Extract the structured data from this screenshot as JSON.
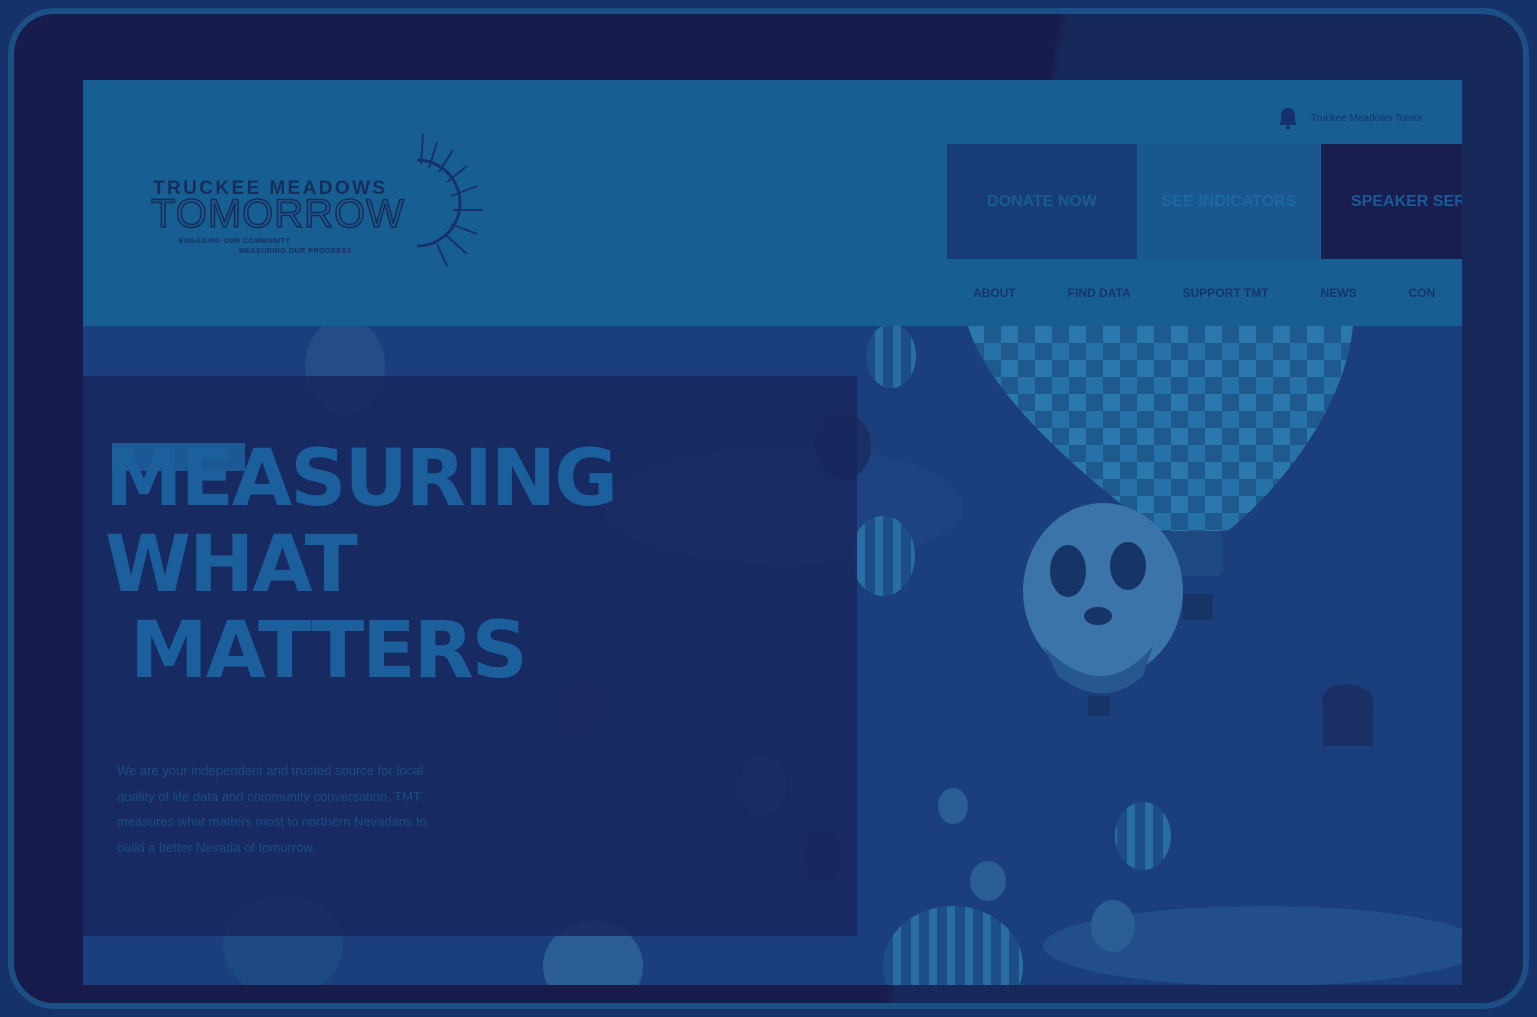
{
  "header": {
    "logo": {
      "line1": "TRUCKEE MEADOWS",
      "line2": "TOMORROW",
      "tagline1": "ENGAGING OUR COMMUNITY",
      "tagline2": "MEASURING OUR PROGRESS"
    },
    "topbar_text": "Truckee Meadows Tomor",
    "cta": {
      "donate": "DONATE NOW",
      "indicators": "SEE INDICATORS",
      "speaker": "SPEAKER SER"
    },
    "nav": [
      "ABOUT",
      "FIND DATA",
      "SUPPORT TMT",
      "NEWS",
      "CON"
    ]
  },
  "hero": {
    "headline": "MEASURING\nWHAT\n MATTERS",
    "description": "We are your independent and trusted source for local quality of life data and community conversation. TMT measures what matters most to northern Nevadans to build a better Nevada of tomorrow."
  },
  "colors": {
    "device_frame": "#181c4d",
    "header_bg": "#175f93",
    "headline": "#1c5f9d"
  },
  "icons": [
    "bell-icon",
    "sun-icon"
  ]
}
